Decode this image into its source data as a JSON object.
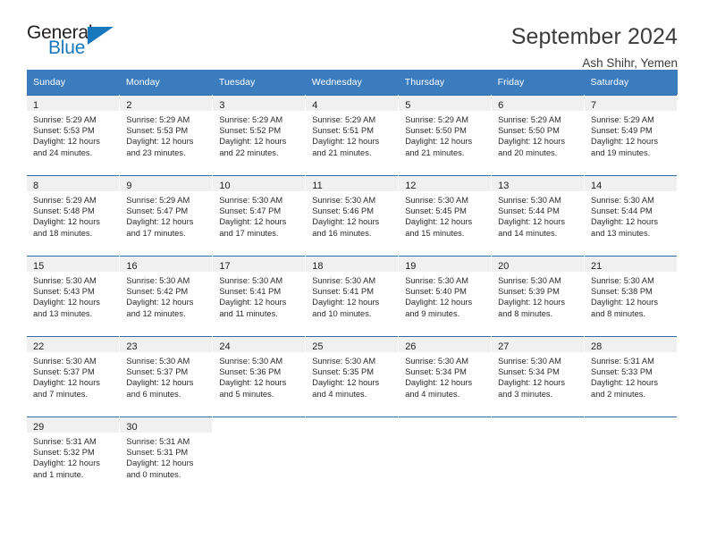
{
  "brand": {
    "name_part1": "General",
    "name_part2": "Blue",
    "accent_color": "#1878be",
    "triangle_icon": "triangle-icon"
  },
  "header": {
    "title": "September 2024",
    "subtitle": "Ash Shihr, Yemen"
  },
  "calendar": {
    "header_bg": "#3a7cbe",
    "row_divider_color": "#2e6da4",
    "daynum_bg": "#f0f0f0",
    "weekday_headers": [
      "Sunday",
      "Monday",
      "Tuesday",
      "Wednesday",
      "Thursday",
      "Friday",
      "Saturday"
    ],
    "weeks": [
      [
        {
          "day": "1",
          "sunrise": "Sunrise: 5:29 AM",
          "sunset": "Sunset: 5:53 PM",
          "daylight_line1": "Daylight: 12 hours",
          "daylight_line2": "and 24 minutes."
        },
        {
          "day": "2",
          "sunrise": "Sunrise: 5:29 AM",
          "sunset": "Sunset: 5:53 PM",
          "daylight_line1": "Daylight: 12 hours",
          "daylight_line2": "and 23 minutes."
        },
        {
          "day": "3",
          "sunrise": "Sunrise: 5:29 AM",
          "sunset": "Sunset: 5:52 PM",
          "daylight_line1": "Daylight: 12 hours",
          "daylight_line2": "and 22 minutes."
        },
        {
          "day": "4",
          "sunrise": "Sunrise: 5:29 AM",
          "sunset": "Sunset: 5:51 PM",
          "daylight_line1": "Daylight: 12 hours",
          "daylight_line2": "and 21 minutes."
        },
        {
          "day": "5",
          "sunrise": "Sunrise: 5:29 AM",
          "sunset": "Sunset: 5:50 PM",
          "daylight_line1": "Daylight: 12 hours",
          "daylight_line2": "and 21 minutes."
        },
        {
          "day": "6",
          "sunrise": "Sunrise: 5:29 AM",
          "sunset": "Sunset: 5:50 PM",
          "daylight_line1": "Daylight: 12 hours",
          "daylight_line2": "and 20 minutes."
        },
        {
          "day": "7",
          "sunrise": "Sunrise: 5:29 AM",
          "sunset": "Sunset: 5:49 PM",
          "daylight_line1": "Daylight: 12 hours",
          "daylight_line2": "and 19 minutes."
        }
      ],
      [
        {
          "day": "8",
          "sunrise": "Sunrise: 5:29 AM",
          "sunset": "Sunset: 5:48 PM",
          "daylight_line1": "Daylight: 12 hours",
          "daylight_line2": "and 18 minutes."
        },
        {
          "day": "9",
          "sunrise": "Sunrise: 5:29 AM",
          "sunset": "Sunset: 5:47 PM",
          "daylight_line1": "Daylight: 12 hours",
          "daylight_line2": "and 17 minutes."
        },
        {
          "day": "10",
          "sunrise": "Sunrise: 5:30 AM",
          "sunset": "Sunset: 5:47 PM",
          "daylight_line1": "Daylight: 12 hours",
          "daylight_line2": "and 17 minutes."
        },
        {
          "day": "11",
          "sunrise": "Sunrise: 5:30 AM",
          "sunset": "Sunset: 5:46 PM",
          "daylight_line1": "Daylight: 12 hours",
          "daylight_line2": "and 16 minutes."
        },
        {
          "day": "12",
          "sunrise": "Sunrise: 5:30 AM",
          "sunset": "Sunset: 5:45 PM",
          "daylight_line1": "Daylight: 12 hours",
          "daylight_line2": "and 15 minutes."
        },
        {
          "day": "13",
          "sunrise": "Sunrise: 5:30 AM",
          "sunset": "Sunset: 5:44 PM",
          "daylight_line1": "Daylight: 12 hours",
          "daylight_line2": "and 14 minutes."
        },
        {
          "day": "14",
          "sunrise": "Sunrise: 5:30 AM",
          "sunset": "Sunset: 5:44 PM",
          "daylight_line1": "Daylight: 12 hours",
          "daylight_line2": "and 13 minutes."
        }
      ],
      [
        {
          "day": "15",
          "sunrise": "Sunrise: 5:30 AM",
          "sunset": "Sunset: 5:43 PM",
          "daylight_line1": "Daylight: 12 hours",
          "daylight_line2": "and 13 minutes."
        },
        {
          "day": "16",
          "sunrise": "Sunrise: 5:30 AM",
          "sunset": "Sunset: 5:42 PM",
          "daylight_line1": "Daylight: 12 hours",
          "daylight_line2": "and 12 minutes."
        },
        {
          "day": "17",
          "sunrise": "Sunrise: 5:30 AM",
          "sunset": "Sunset: 5:41 PM",
          "daylight_line1": "Daylight: 12 hours",
          "daylight_line2": "and 11 minutes."
        },
        {
          "day": "18",
          "sunrise": "Sunrise: 5:30 AM",
          "sunset": "Sunset: 5:41 PM",
          "daylight_line1": "Daylight: 12 hours",
          "daylight_line2": "and 10 minutes."
        },
        {
          "day": "19",
          "sunrise": "Sunrise: 5:30 AM",
          "sunset": "Sunset: 5:40 PM",
          "daylight_line1": "Daylight: 12 hours",
          "daylight_line2": "and 9 minutes."
        },
        {
          "day": "20",
          "sunrise": "Sunrise: 5:30 AM",
          "sunset": "Sunset: 5:39 PM",
          "daylight_line1": "Daylight: 12 hours",
          "daylight_line2": "and 8 minutes."
        },
        {
          "day": "21",
          "sunrise": "Sunrise: 5:30 AM",
          "sunset": "Sunset: 5:38 PM",
          "daylight_line1": "Daylight: 12 hours",
          "daylight_line2": "and 8 minutes."
        }
      ],
      [
        {
          "day": "22",
          "sunrise": "Sunrise: 5:30 AM",
          "sunset": "Sunset: 5:37 PM",
          "daylight_line1": "Daylight: 12 hours",
          "daylight_line2": "and 7 minutes."
        },
        {
          "day": "23",
          "sunrise": "Sunrise: 5:30 AM",
          "sunset": "Sunset: 5:37 PM",
          "daylight_line1": "Daylight: 12 hours",
          "daylight_line2": "and 6 minutes."
        },
        {
          "day": "24",
          "sunrise": "Sunrise: 5:30 AM",
          "sunset": "Sunset: 5:36 PM",
          "daylight_line1": "Daylight: 12 hours",
          "daylight_line2": "and 5 minutes."
        },
        {
          "day": "25",
          "sunrise": "Sunrise: 5:30 AM",
          "sunset": "Sunset: 5:35 PM",
          "daylight_line1": "Daylight: 12 hours",
          "daylight_line2": "and 4 minutes."
        },
        {
          "day": "26",
          "sunrise": "Sunrise: 5:30 AM",
          "sunset": "Sunset: 5:34 PM",
          "daylight_line1": "Daylight: 12 hours",
          "daylight_line2": "and 4 minutes."
        },
        {
          "day": "27",
          "sunrise": "Sunrise: 5:30 AM",
          "sunset": "Sunset: 5:34 PM",
          "daylight_line1": "Daylight: 12 hours",
          "daylight_line2": "and 3 minutes."
        },
        {
          "day": "28",
          "sunrise": "Sunrise: 5:31 AM",
          "sunset": "Sunset: 5:33 PM",
          "daylight_line1": "Daylight: 12 hours",
          "daylight_line2": "and 2 minutes."
        }
      ],
      [
        {
          "day": "29",
          "sunrise": "Sunrise: 5:31 AM",
          "sunset": "Sunset: 5:32 PM",
          "daylight_line1": "Daylight: 12 hours",
          "daylight_line2": "and 1 minute."
        },
        {
          "day": "30",
          "sunrise": "Sunrise: 5:31 AM",
          "sunset": "Sunset: 5:31 PM",
          "daylight_line1": "Daylight: 12 hours",
          "daylight_line2": "and 0 minutes."
        },
        {
          "day": "",
          "sunrise": "",
          "sunset": "",
          "daylight_line1": "",
          "daylight_line2": ""
        },
        {
          "day": "",
          "sunrise": "",
          "sunset": "",
          "daylight_line1": "",
          "daylight_line2": ""
        },
        {
          "day": "",
          "sunrise": "",
          "sunset": "",
          "daylight_line1": "",
          "daylight_line2": ""
        },
        {
          "day": "",
          "sunrise": "",
          "sunset": "",
          "daylight_line1": "",
          "daylight_line2": ""
        },
        {
          "day": "",
          "sunrise": "",
          "sunset": "",
          "daylight_line1": "",
          "daylight_line2": ""
        }
      ]
    ]
  }
}
